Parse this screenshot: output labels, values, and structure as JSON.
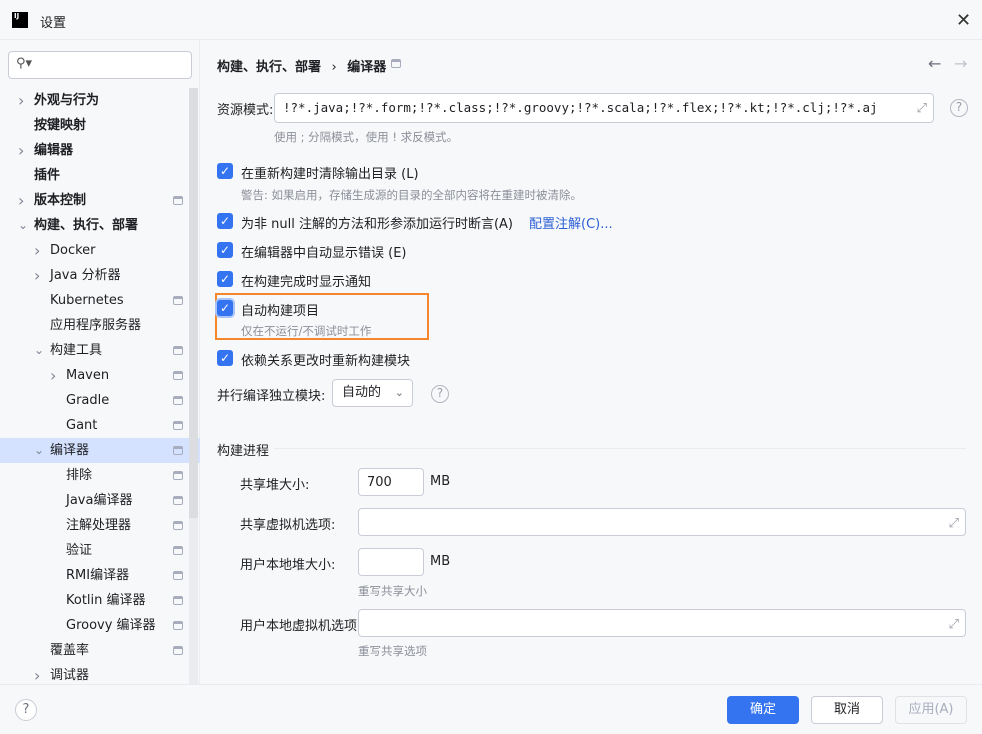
{
  "window": {
    "title": "设置",
    "close_icon": "close-icon"
  },
  "search": {
    "placeholder": "",
    "icon": "search-icon"
  },
  "sidebar": {
    "items": [
      {
        "label": "外观与行为",
        "level": 0,
        "chevron": "right",
        "pin": false
      },
      {
        "label": "按键映射",
        "level": 0,
        "chevron": "",
        "pin": false
      },
      {
        "label": "编辑器",
        "level": 0,
        "chevron": "right",
        "pin": false
      },
      {
        "label": "插件",
        "level": 0,
        "chevron": "",
        "pin": false
      },
      {
        "label": "版本控制",
        "level": 0,
        "chevron": "right",
        "pin": true
      },
      {
        "label": "构建、执行、部署",
        "level": 0,
        "chevron": "down",
        "pin": false
      },
      {
        "label": "Docker",
        "level": 1,
        "chevron": "right",
        "pin": false
      },
      {
        "label": "Java 分析器",
        "level": 1,
        "chevron": "right",
        "pin": false
      },
      {
        "label": "Kubernetes",
        "level": 1,
        "chevron": "",
        "pin": true
      },
      {
        "label": "应用程序服务器",
        "level": 1,
        "chevron": "",
        "pin": false
      },
      {
        "label": "构建工具",
        "level": 1,
        "chevron": "down",
        "pin": true
      },
      {
        "label": "Maven",
        "level": 2,
        "chevron": "right",
        "pin": true
      },
      {
        "label": "Gradle",
        "level": 2,
        "chevron": "",
        "pin": true
      },
      {
        "label": "Gant",
        "level": 2,
        "chevron": "",
        "pin": true
      },
      {
        "label": "编译器",
        "level": 1,
        "chevron": "down",
        "pin": true,
        "selected": true
      },
      {
        "label": "排除",
        "level": 2,
        "chevron": "",
        "pin": true
      },
      {
        "label": "Java编译器",
        "level": 2,
        "chevron": "",
        "pin": true
      },
      {
        "label": "注解处理器",
        "level": 2,
        "chevron": "",
        "pin": true
      },
      {
        "label": "验证",
        "level": 2,
        "chevron": "",
        "pin": true
      },
      {
        "label": "RMI编译器",
        "level": 2,
        "chevron": "",
        "pin": true
      },
      {
        "label": "Kotlin 编译器",
        "level": 2,
        "chevron": "",
        "pin": true
      },
      {
        "label": "Groovy 编译器",
        "level": 2,
        "chevron": "",
        "pin": true
      },
      {
        "label": "覆盖率",
        "level": 1,
        "chevron": "",
        "pin": true
      },
      {
        "label": "调试器",
        "level": 1,
        "chevron": "right",
        "pin": false
      }
    ]
  },
  "main": {
    "breadcrumb": {
      "parent": "构建、执行、部署",
      "separator": "›",
      "current": "编译器"
    },
    "resource_patterns": {
      "label": "资源模式:",
      "value": "!?*.java;!?*.form;!?*.class;!?*.groovy;!?*.scala;!?*.flex;!?*.kt;!?*.clj;!?*.aj",
      "hint": "使用 ; 分隔模式，使用 ! 求反模式。"
    },
    "options": [
      {
        "label": "在重新构建时清除输出目录 (L)",
        "checked": true,
        "hint": "警告: 如果启用，存储生成源的目录的全部内容将在重建时被清除。"
      },
      {
        "label": "为非 null 注解的方法和形参添加运行时断言(A)",
        "checked": true,
        "link": "配置注解(C)..."
      },
      {
        "label": "在编辑器中自动显示错误 (E)",
        "checked": true
      },
      {
        "label": "在构建完成时显示通知",
        "checked": true
      },
      {
        "label": "自动构建项目",
        "checked": true,
        "hint": "仅在不运行/不调试时工作"
      },
      {
        "label": "依赖关系更改时重新构建模块",
        "checked": true
      }
    ],
    "parallel": {
      "label": "并行编译独立模块:",
      "value": "自动的"
    },
    "build_process": {
      "title": "构建进程",
      "shared_heap": {
        "label": "共享堆大小:",
        "value": "700",
        "unit": "MB"
      },
      "shared_vm": {
        "label": "共享虚拟机选项:",
        "value": ""
      },
      "user_heap": {
        "label": "用户本地堆大小:",
        "value": "",
        "unit": "MB",
        "hint": "重写共享大小"
      },
      "user_vm": {
        "label": "用户本地虚拟机选项:",
        "value": "",
        "hint": "重写共享选项"
      }
    }
  },
  "footer": {
    "ok": "确定",
    "cancel": "取消",
    "apply": "应用(A)"
  },
  "colors": {
    "accent": "#3574f0",
    "highlight": "#f5862b",
    "selection": "#d4e2ff"
  }
}
